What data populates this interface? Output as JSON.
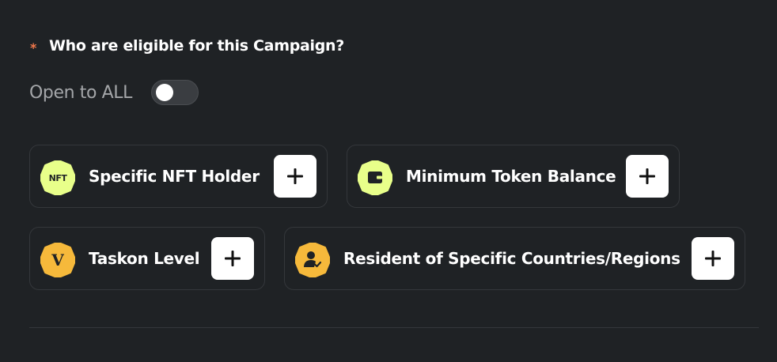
{
  "question": {
    "required_marker": "*",
    "text": "Who are eligible for this Campaign?"
  },
  "open_to_all": {
    "label": "Open to ALL",
    "enabled": false
  },
  "criteria": [
    {
      "label": "Specific NFT Holder",
      "icon": "nft-icon",
      "icon_text": "NFT",
      "icon_color": "#e8ff8a"
    },
    {
      "label": "Minimum Token Balance",
      "icon": "wallet-icon",
      "icon_color": "#e8ff8a"
    },
    {
      "label": "Taskon Level",
      "icon": "level-v-icon",
      "icon_text": "V",
      "icon_color": "#f6b93b"
    },
    {
      "label": "Resident of Specific Countries/Regions",
      "icon": "verified-user-icon",
      "icon_color": "#f6b93b"
    }
  ],
  "colors": {
    "background": "#1f2225",
    "card_border": "#34373b",
    "accent_star": "#f2784b",
    "muted_text": "#a4a6a9"
  }
}
